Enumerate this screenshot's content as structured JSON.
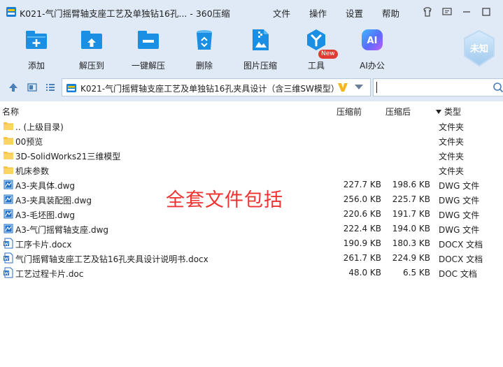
{
  "window": {
    "title": "K021-气门摇臂轴支座工艺及单独钻16孔... - 360压缩",
    "menu": [
      "文件",
      "操作",
      "设置",
      "帮助"
    ]
  },
  "toolbar": {
    "items": [
      {
        "label": "添加",
        "icon": "add-icon"
      },
      {
        "label": "解压到",
        "icon": "extract-to-icon"
      },
      {
        "label": "一键解压",
        "icon": "one-click-extract-icon"
      },
      {
        "label": "删除",
        "icon": "delete-icon"
      },
      {
        "label": "图片压缩",
        "icon": "image-compress-icon"
      },
      {
        "label": "工具",
        "icon": "tools-icon"
      },
      {
        "label": "AI办公",
        "icon": "ai-office-icon"
      }
    ],
    "new_badge": "New",
    "ai_glyph": "AI",
    "activation_label": "未知"
  },
  "address": {
    "path": "K021-气门摇臂轴支座工艺及单独钻16孔夹具设计（含三维SW模型）",
    "search_placeholder": ""
  },
  "columns": {
    "name": "名称",
    "size": "压缩前",
    "packed": "压缩后",
    "type": "类型"
  },
  "files": [
    {
      "name": ".. (上级目录)",
      "size": "",
      "packed": "",
      "type": "文件夹",
      "icon": "folder-icon"
    },
    {
      "name": "00预览",
      "size": "",
      "packed": "",
      "type": "文件夹",
      "icon": "folder-icon"
    },
    {
      "name": "3D-SolidWorks21三维模型",
      "size": "",
      "packed": "",
      "type": "文件夹",
      "icon": "folder-icon"
    },
    {
      "name": "机床参数",
      "size": "",
      "packed": "",
      "type": "文件夹",
      "icon": "folder-icon"
    },
    {
      "name": "A3-夹具体.dwg",
      "size": "227.7 KB",
      "packed": "198.6 KB",
      "type": "DWG 文件",
      "icon": "dwg-file-icon"
    },
    {
      "name": "A3-夹具装配图.dwg",
      "size": "256.0 KB",
      "packed": "225.7 KB",
      "type": "DWG 文件",
      "icon": "dwg-file-icon"
    },
    {
      "name": "A3-毛坯图.dwg",
      "size": "220.6 KB",
      "packed": "191.7 KB",
      "type": "DWG 文件",
      "icon": "dwg-file-icon"
    },
    {
      "name": "A3-气门摇臂轴支座.dwg",
      "size": "222.4 KB",
      "packed": "194.0 KB",
      "type": "DWG 文件",
      "icon": "dwg-file-icon"
    },
    {
      "name": "工序卡片.docx",
      "size": "190.9 KB",
      "packed": "180.3 KB",
      "type": "DOCX 文档",
      "icon": "word-file-icon"
    },
    {
      "name": "气门摇臂轴支座工艺及钻16孔夹具设计说明书.docx",
      "size": "261.7 KB",
      "packed": "224.9 KB",
      "type": "DOCX 文档",
      "icon": "word-file-icon"
    },
    {
      "name": "工艺过程卡片.doc",
      "size": "48.0 KB",
      "packed": "6.5 KB",
      "type": "DOC 文档",
      "icon": "word-file-icon"
    }
  ],
  "overlay_text": "全套文件包括",
  "colors": {
    "accent": "#1a8fe3",
    "overlay": "#ee3333",
    "chrome": "#dfeaf6"
  }
}
